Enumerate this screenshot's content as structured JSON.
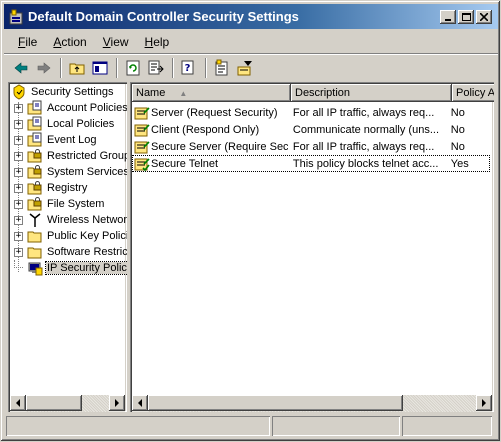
{
  "window": {
    "title": "Default Domain Controller Security Settings",
    "controls": {
      "minimize": "_",
      "maximize": "□",
      "close": "×"
    }
  },
  "menu": [
    {
      "label": "File",
      "accel": "F",
      "rest": "ile"
    },
    {
      "label": "Action",
      "accel": "A",
      "rest": "ction"
    },
    {
      "label": "View",
      "accel": "V",
      "rest": "iew"
    },
    {
      "label": "Help",
      "accel": "H",
      "rest": "elp"
    }
  ],
  "toolbar": {
    "icons": [
      "back-arrow-icon",
      "forward-arrow-icon",
      "up-folder-icon",
      "show-hide-tree-icon",
      "refresh-icon",
      "export-list-icon",
      "help-icon",
      "properties-icon",
      "filter-icon"
    ]
  },
  "tree": {
    "root": "Security Settings",
    "items": [
      {
        "label": "Account Policies",
        "icon": "policy-folder-icon",
        "expandable": true
      },
      {
        "label": "Local Policies",
        "icon": "policy-folder-icon",
        "expandable": true
      },
      {
        "label": "Event Log",
        "icon": "policy-folder-icon",
        "expandable": true
      },
      {
        "label": "Restricted Groups",
        "icon": "folder-lock-icon",
        "expandable": true
      },
      {
        "label": "System Services",
        "icon": "folder-lock-icon",
        "expandable": true
      },
      {
        "label": "Registry",
        "icon": "folder-lock-icon",
        "expandable": true
      },
      {
        "label": "File System",
        "icon": "folder-lock-icon",
        "expandable": true
      },
      {
        "label": "Wireless Network",
        "icon": "antenna-icon",
        "expandable": true
      },
      {
        "label": "Public Key Policies",
        "icon": "folder-icon",
        "expandable": true
      },
      {
        "label": "Software Restriction",
        "icon": "folder-icon",
        "expandable": true
      },
      {
        "label": "IP Security Policies",
        "icon": "ip-security-icon",
        "expandable": false,
        "selected": true
      }
    ]
  },
  "list": {
    "columns": [
      {
        "label": "Name",
        "sort": "▲"
      },
      {
        "label": "Description"
      },
      {
        "label": "Policy Assigned"
      }
    ],
    "rows": [
      {
        "name": "Server (Request Security)",
        "description": "For all IP traffic, always req...",
        "assigned": "No"
      },
      {
        "name": "Client (Respond Only)",
        "description": "Communicate normally (uns...",
        "assigned": "No"
      },
      {
        "name": "Secure Server (Require Security)",
        "description": "For all IP traffic, always req...",
        "assigned": "No"
      },
      {
        "name": "Secure Telnet",
        "description": "This policy blocks telnet acc...",
        "assigned": "Yes",
        "focused": true
      }
    ]
  },
  "colors": {
    "title_gradient_start": "#0a246a",
    "title_gradient_end": "#a6caf0",
    "face": "#d4d0c8"
  }
}
